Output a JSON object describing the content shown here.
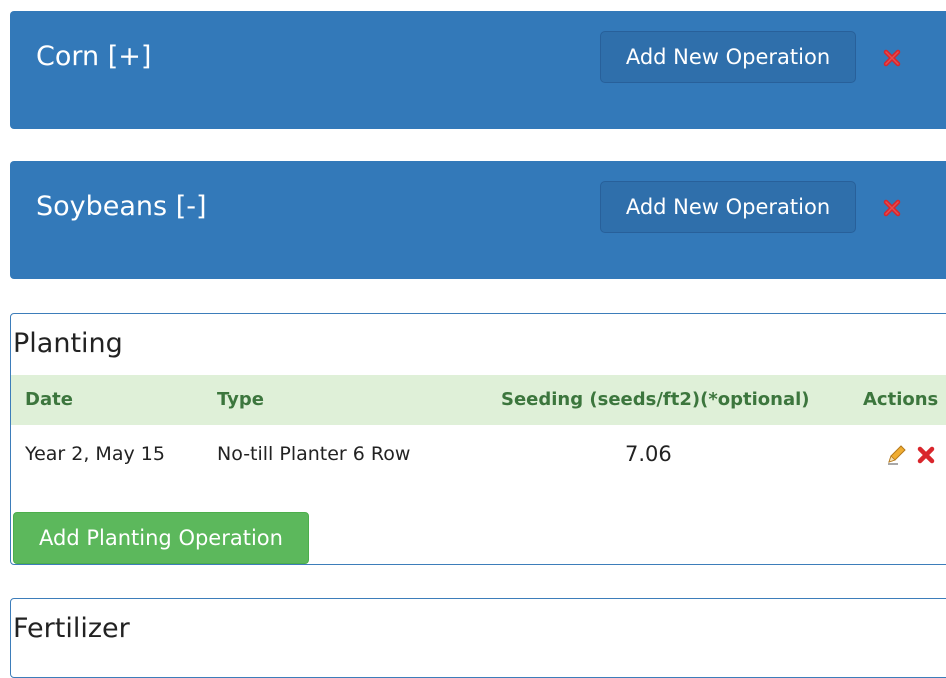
{
  "crops": [
    {
      "title": "Corn [+]",
      "add_label": "Add New Operation",
      "delete_icon": "red-x-icon"
    },
    {
      "title": "Soybeans [-]",
      "add_label": "Add New Operation",
      "delete_icon": "red-x-icon"
    }
  ],
  "planting": {
    "title": "Planting",
    "columns": [
      "Date",
      "Type",
      "Seeding (seeds/ft2)(*optional)",
      "Actions"
    ],
    "rows": [
      {
        "date": "Year 2, May 15",
        "type": "No-till Planter 6 Row",
        "seeding": "7.06",
        "actions": [
          "pencil-icon",
          "red-x-icon"
        ]
      }
    ],
    "add_label": "Add Planting Operation"
  },
  "fertilizer": {
    "title": "Fertilizer"
  },
  "colors": {
    "panel_blue": "#3379b9",
    "button_blue": "#2f6fab",
    "table_header_green_bg": "#dff0d8",
    "table_header_green_text": "#3c763d",
    "success_green": "#5cb85c",
    "delete_red": "#d9262c"
  }
}
